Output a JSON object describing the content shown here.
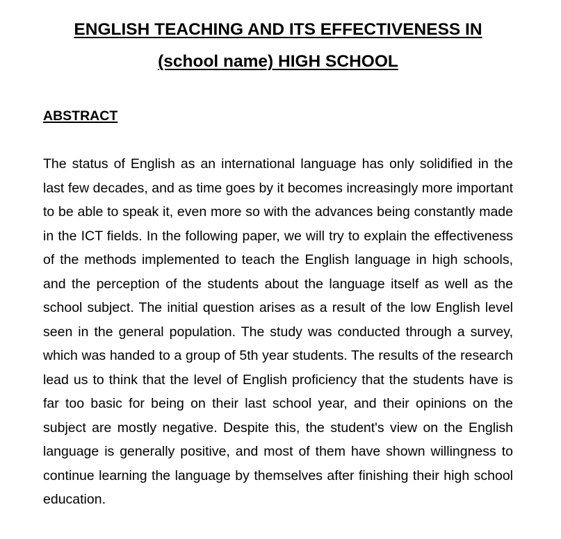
{
  "document": {
    "title_line1": "ENGLISH TEACHING AND ITS EFFECTIVENESS IN",
    "title_line2": "(school name) HIGH SCHOOL",
    "section_heading": "ABSTRACT",
    "abstract_text": "The status of English as an international language has only solidified in the last few decades, and as time goes by it becomes increasingly more important to be able to speak it, even more so with the advances being constantly made in the ICT fields. In the following paper, we will try to explain the effectiveness of the methods implemented to teach the English language in high schools, and the perception of the students about the language itself as well as the school subject. The initial question arises as a result of the low English level seen in the general population. The study was conducted through a survey, which was handed to a group of 5th year students. The results of the research lead us to think that the level of English proficiency that the students have is far too basic for being on their last school year, and their opinions on the subject are mostly negative. Despite this, the student's view on the English language is generally positive, and most of them have shown willingness to continue learning the language by themselves after finishing their high school education."
  }
}
